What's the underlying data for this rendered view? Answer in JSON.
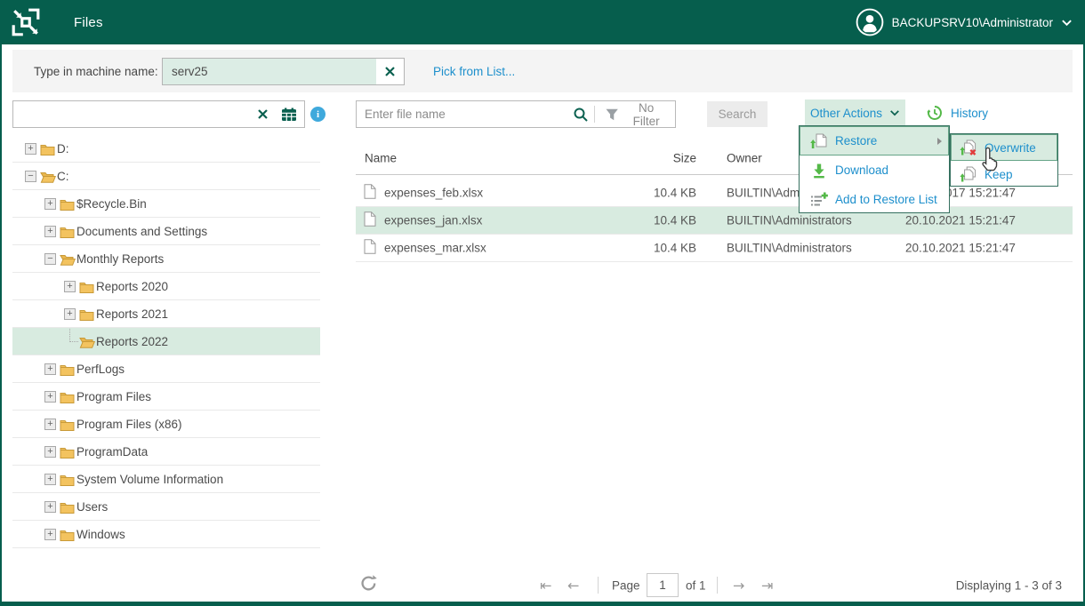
{
  "topbar": {
    "title": "Files",
    "user": "BACKUPSRV10\\Administrator"
  },
  "machine_bar": {
    "label": "Type in machine name:",
    "value": "serv25",
    "pick_from_list": "Pick from List..."
  },
  "tree_panel": {
    "search_value": "",
    "items": [
      {
        "label": "D:",
        "level": 1,
        "expander": "plus",
        "folder": "closed",
        "selected": false
      },
      {
        "label": "C:",
        "level": 1,
        "expander": "minus",
        "folder": "open",
        "selected": false
      },
      {
        "label": "$Recycle.Bin",
        "level": 2,
        "expander": "plus",
        "folder": "closed",
        "selected": false
      },
      {
        "label": "Documents and Settings",
        "level": 2,
        "expander": "plus",
        "folder": "closed",
        "selected": false
      },
      {
        "label": "Monthly Reports",
        "level": 2,
        "expander": "minus",
        "folder": "open",
        "selected": false
      },
      {
        "label": "Reports 2020",
        "level": 3,
        "expander": "plus",
        "folder": "closed",
        "selected": false
      },
      {
        "label": "Reports 2021",
        "level": 3,
        "expander": "plus",
        "folder": "closed",
        "selected": false
      },
      {
        "label": "Reports 2022",
        "level": 3,
        "expander": "none",
        "folder": "open",
        "selected": true
      },
      {
        "label": "PerfLogs",
        "level": 2,
        "expander": "plus",
        "folder": "closed",
        "selected": false
      },
      {
        "label": "Program Files",
        "level": 2,
        "expander": "plus",
        "folder": "closed",
        "selected": false
      },
      {
        "label": "Program Files (x86)",
        "level": 2,
        "expander": "plus",
        "folder": "closed",
        "selected": false
      },
      {
        "label": "ProgramData",
        "level": 2,
        "expander": "plus",
        "folder": "closed",
        "selected": false
      },
      {
        "label": "System Volume Information",
        "level": 2,
        "expander": "plus",
        "folder": "closed",
        "selected": false
      },
      {
        "label": "Users",
        "level": 2,
        "expander": "plus",
        "folder": "closed",
        "selected": false
      },
      {
        "label": "Windows",
        "level": 2,
        "expander": "plus",
        "folder": "closed",
        "selected": false
      }
    ]
  },
  "files_toolbar": {
    "search_placeholder": "Enter file name",
    "filter_label": "No Filter",
    "search_button": "Search",
    "other_actions_button": "Other Actions",
    "history_button": "History"
  },
  "files_table": {
    "columns": {
      "name": "Name",
      "size": "Size",
      "owner": "Owner",
      "modified": ""
    },
    "rows": [
      {
        "name": "expenses_feb.xlsx",
        "size": "10.4 KB",
        "owner": "BUILTIN\\Administrators",
        "modified": "20.10.2017 15:21:47",
        "selected": false
      },
      {
        "name": "expenses_jan.xlsx",
        "size": "10.4 KB",
        "owner": "BUILTIN\\Administrators",
        "modified": "20.10.2021 15:21:47",
        "selected": true
      },
      {
        "name": "expenses_mar.xlsx",
        "size": "10.4 KB",
        "owner": "BUILTIN\\Administrators",
        "modified": "20.10.2021 15:21:47",
        "selected": false
      }
    ]
  },
  "actions_menu": {
    "items": [
      {
        "label": "Restore",
        "icon": "restore-icon",
        "highlighted": true,
        "has_submenu": true
      },
      {
        "label": "Download",
        "icon": "download-icon",
        "highlighted": false,
        "has_submenu": false
      },
      {
        "label": "Add to Restore List",
        "icon": "add-to-restore-list-icon",
        "highlighted": false,
        "has_submenu": false
      }
    ]
  },
  "restore_submenu": {
    "items": [
      {
        "label": "Overwrite",
        "icon": "overwrite-icon",
        "highlighted": true
      },
      {
        "label": "Keep",
        "icon": "keep-icon",
        "highlighted": false
      }
    ]
  },
  "pagination": {
    "page_label": "Page",
    "page_value": "1",
    "of_label": "of 1",
    "displaying": "Displaying 1 - 3 of 3"
  },
  "colors": {
    "header_green": "#065e4d",
    "accent_green": "#54b948",
    "link_blue": "#1d8fcc",
    "selection_green": "#d8ebe0",
    "folder_yellow": "#f3c35f",
    "danger_red": "#e23b3b"
  }
}
